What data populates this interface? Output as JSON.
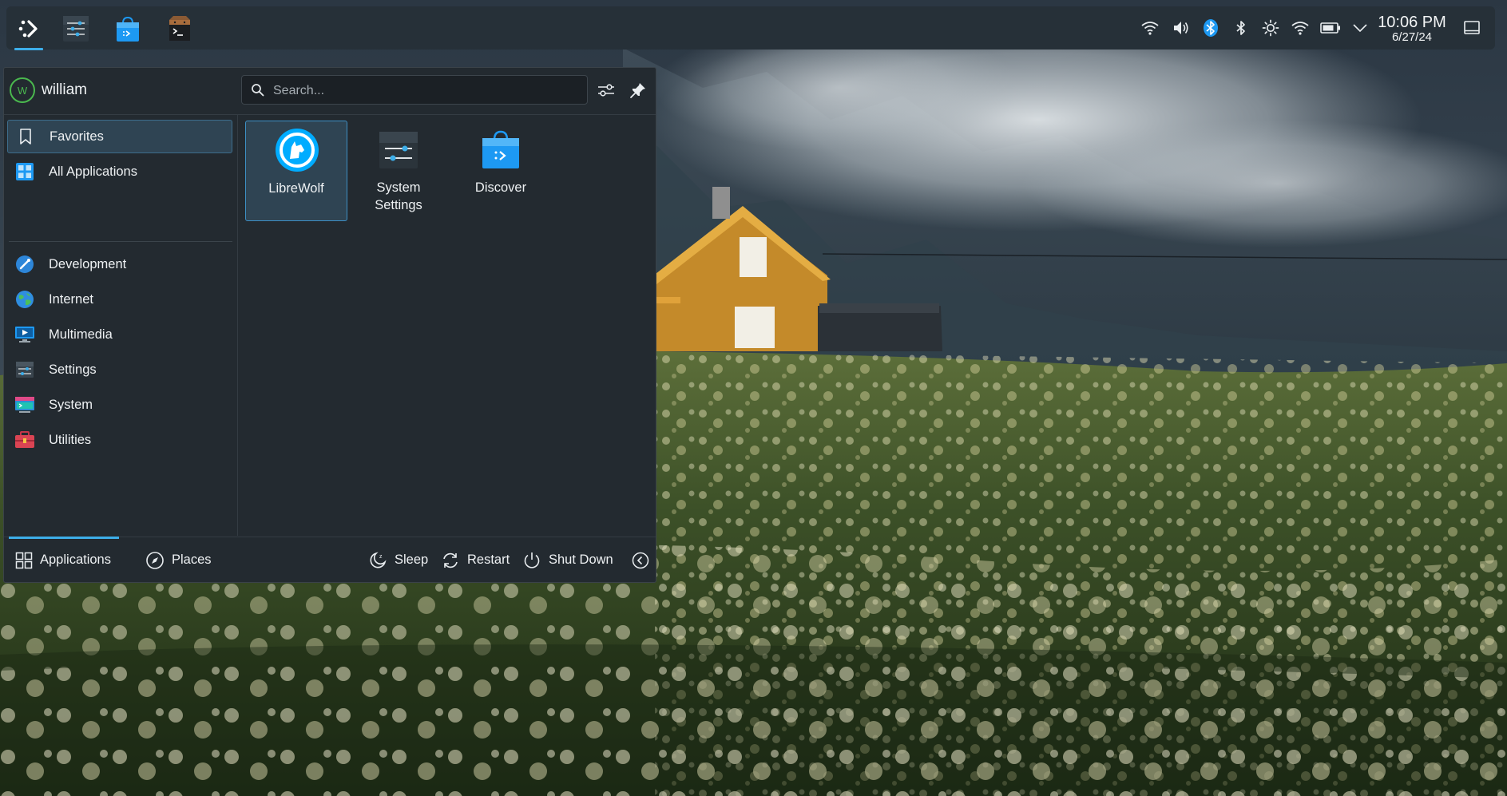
{
  "panel": {
    "tasks": [
      {
        "name": "application-launcher",
        "icon": "kde-launcher-icon",
        "active": true
      },
      {
        "name": "system-settings",
        "icon": "settings-sliders-icon",
        "active": false
      },
      {
        "name": "discover",
        "icon": "store-bag-icon",
        "active": false
      },
      {
        "name": "terminal",
        "icon": "terminal-icon",
        "active": false
      }
    ],
    "tray": [
      "wifi-icon",
      "volume-icon",
      "bluetooth-blue-icon",
      "bluetooth-icon",
      "brightness-icon",
      "network-icon",
      "battery-icon",
      "chevron-down-icon"
    ],
    "clock": {
      "time": "10:06 PM",
      "date": "6/27/24"
    },
    "show_desktop_icon": "show-desktop-icon"
  },
  "launcher": {
    "user": {
      "name": "william",
      "initial": "W"
    },
    "search": {
      "placeholder": "Search..."
    },
    "header_buttons": [
      "configure-sliders-icon",
      "pin-icon"
    ],
    "categories": [
      {
        "label": "Favorites",
        "icon": "bookmark-icon",
        "selected": true
      },
      {
        "label": "All Applications",
        "icon": "grid-apps-icon",
        "selected": false
      },
      {
        "label": "Development",
        "icon": "development-icon",
        "selected": false
      },
      {
        "label": "Internet",
        "icon": "globe-icon",
        "selected": false
      },
      {
        "label": "Multimedia",
        "icon": "multimedia-icon",
        "selected": false
      },
      {
        "label": "Settings",
        "icon": "settings-icon",
        "selected": false
      },
      {
        "label": "System",
        "icon": "system-icon",
        "selected": false
      },
      {
        "label": "Utilities",
        "icon": "toolbox-icon",
        "selected": false
      }
    ],
    "favorites": [
      {
        "label": "LibreWolf",
        "icon": "librewolf-icon",
        "selected": true
      },
      {
        "label": "System\nSettings",
        "label_line1": "System",
        "label_line2": "Settings",
        "icon": "system-settings-icon",
        "selected": false
      },
      {
        "label": "Discover",
        "icon": "discover-icon",
        "selected": false
      }
    ],
    "footer": {
      "tabs": [
        {
          "label": "Applications",
          "icon": "applications-grid-icon",
          "active": true
        },
        {
          "label": "Places",
          "icon": "compass-icon",
          "active": false
        }
      ],
      "actions": [
        {
          "label": "Sleep",
          "icon": "sleep-icon"
        },
        {
          "label": "Restart",
          "icon": "restart-icon"
        },
        {
          "label": "Shut Down",
          "icon": "power-icon"
        }
      ],
      "more_icon": "chevron-left-circle-icon"
    }
  },
  "colors": {
    "accent": "#3daee9",
    "panel": "#263038",
    "menu_bg": "#232a30",
    "avatar_ring": "#4ab84e"
  }
}
